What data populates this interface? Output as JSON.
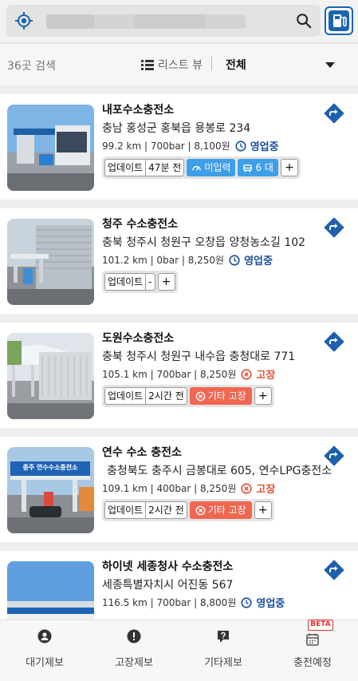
{
  "search": {
    "placeholder": ""
  },
  "filter": {
    "count": "36곳 검색",
    "view_label": "리스트 뷰",
    "value": "전체"
  },
  "status_colors": {
    "open": "#1b4f9c",
    "broken": "#e0503a",
    "accent": "#1a64b0"
  },
  "stations": [
    {
      "name": "내포수소충전소",
      "address": "충남 홍성군 홍북읍 용봉로 234",
      "meta": "99.2 km | 700bar | 8,100원",
      "status": "영업중",
      "status_type": "open",
      "update_label": "업데이트",
      "update_time": "47분 전",
      "pressure_label": "미입력",
      "waiting_label": "6 대",
      "plus": "+"
    },
    {
      "name": "청주 수소충전소",
      "address": "충북 청주시 청원구 오창읍 양청농소길 102",
      "meta": "101.2 km | 0bar | 8,250원",
      "status": "영업중",
      "status_type": "open",
      "update_label": "업데이트",
      "update_time": "-",
      "plus": "+"
    },
    {
      "name": "도원수소충전소",
      "address": "충북 청주시 청원구 내수읍 충청대로 771",
      "meta": "105.1 km | 700bar | 8,250원",
      "status": "고장",
      "status_type": "broken",
      "update_label": "업데이트",
      "update_time": "2시간 전",
      "fault_label": "기타 고장",
      "plus": "+"
    },
    {
      "name": "연수 수소 충전소",
      "address": "충청북도 충주시 금봉대로 605, 연수LPG충전소",
      "meta": "109.1 km | 400bar | 8,250원",
      "status": "고장",
      "status_type": "broken",
      "update_label": "업데이트",
      "update_time": "2시간 전",
      "fault_label": "기타 고장",
      "plus": "+",
      "photo_sign": "충주 연수수소충전소"
    },
    {
      "name": "하이넷 세종청사 수소충전소",
      "address": "세종특별자치시 어진동 567",
      "meta": "116.5 km | 700bar | 8,800원",
      "status": "영업중",
      "status_type": "open"
    }
  ],
  "bottom_nav": [
    {
      "label": "대기제보",
      "icon": "person-icon"
    },
    {
      "label": "고장제보",
      "icon": "alert-icon"
    },
    {
      "label": "기타제보",
      "icon": "question-icon"
    },
    {
      "label": "충전예정",
      "icon": "calendar-icon"
    }
  ],
  "beta_badge": "BETA"
}
